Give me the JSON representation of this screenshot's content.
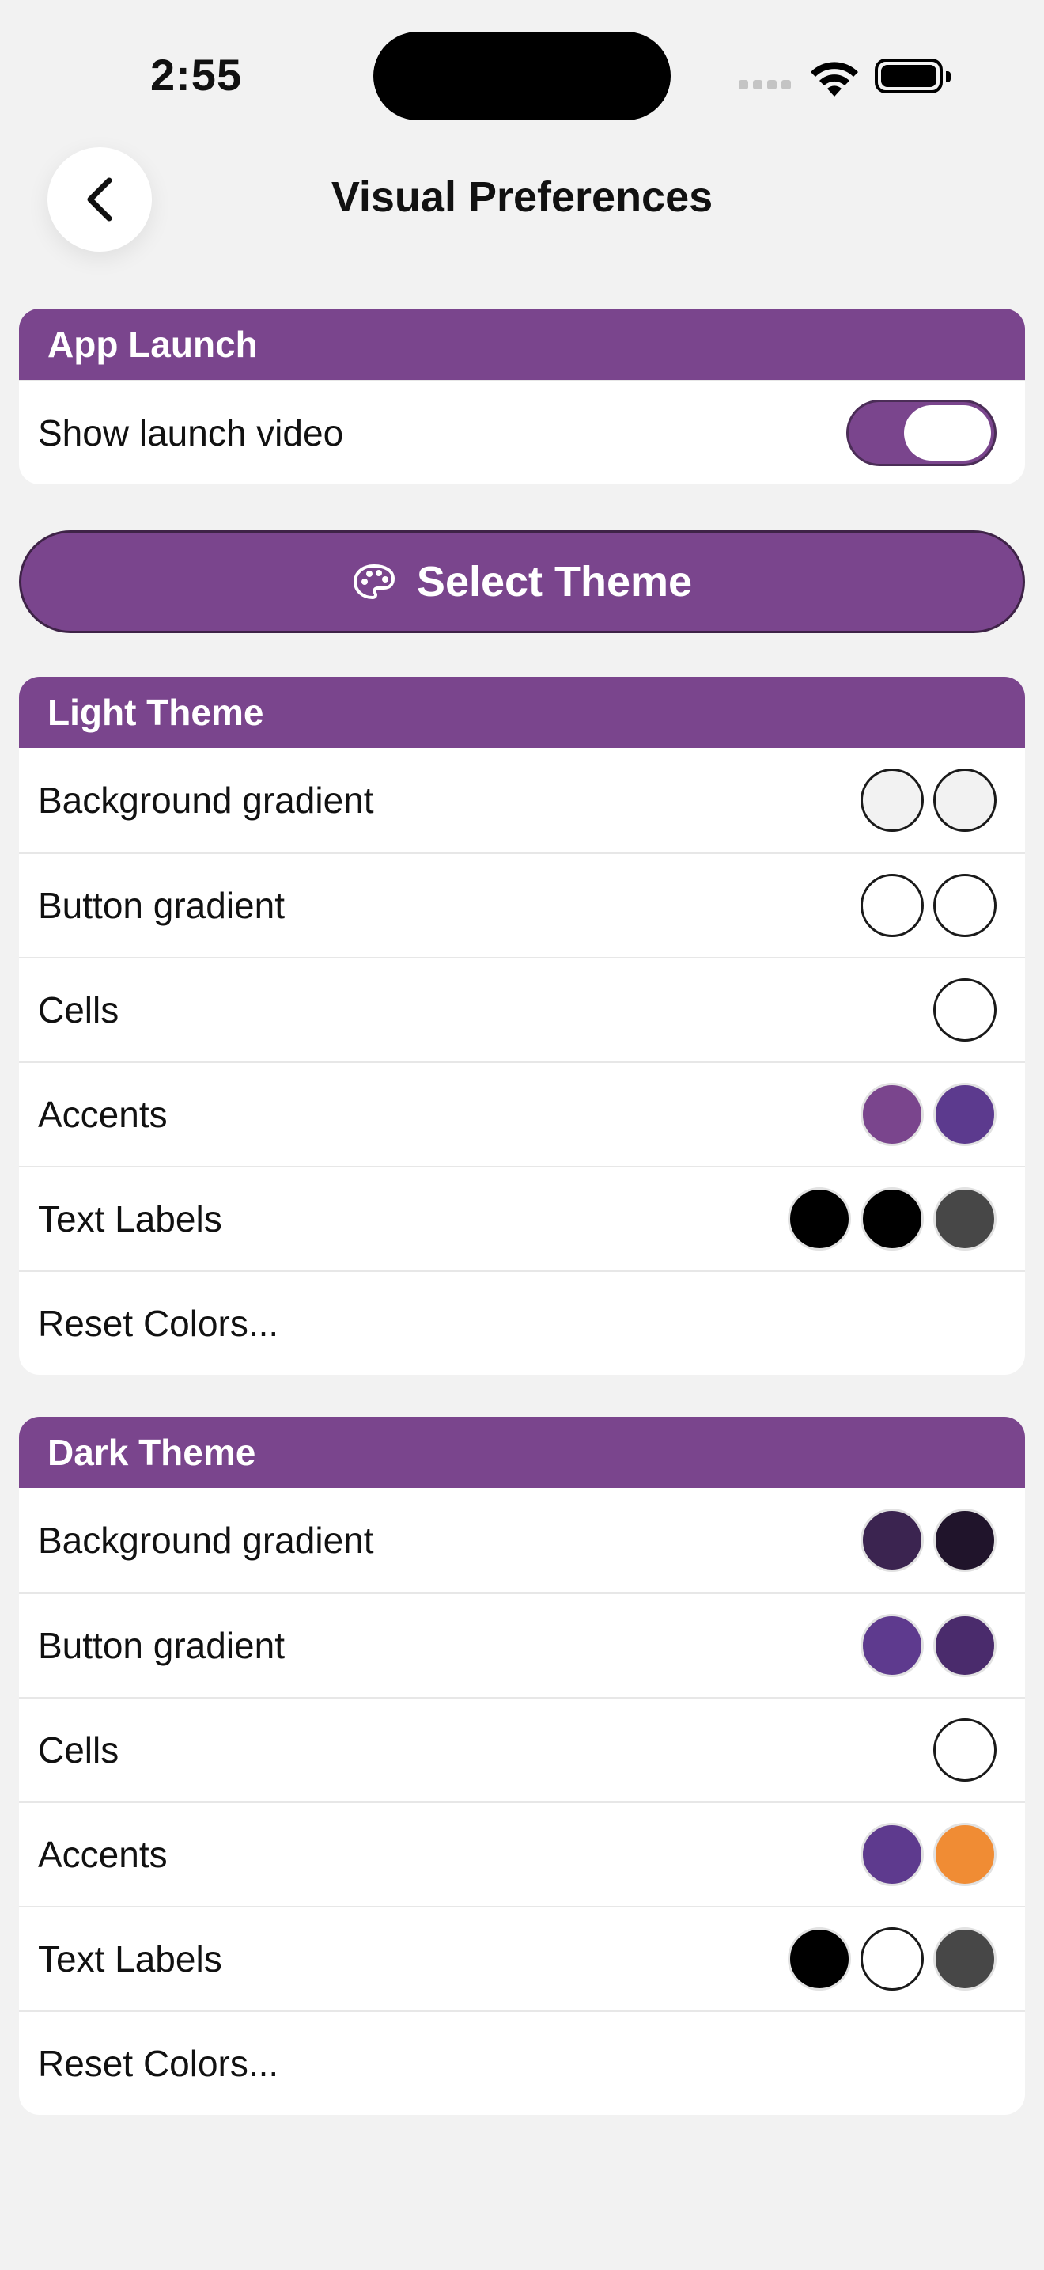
{
  "status_bar": {
    "time": "2:55"
  },
  "nav": {
    "title": "Visual Preferences",
    "back_icon": "chevron-left-icon"
  },
  "app_launch": {
    "header": "App Launch",
    "show_launch_video_label": "Show launch video",
    "show_launch_video_on": true
  },
  "select_theme": {
    "label": "Select Theme",
    "icon": "palette-icon"
  },
  "light_theme": {
    "header": "Light Theme",
    "rows": [
      {
        "label": "Background gradient",
        "colors": [
          "#f2f2f2",
          "#f2f2f2"
        ]
      },
      {
        "label": "Button gradient",
        "colors": [
          "#ffffff",
          "#ffffff"
        ]
      },
      {
        "label": "Cells",
        "colors": [
          "#ffffff"
        ]
      },
      {
        "label": "Accents",
        "colors": [
          "#7a458d",
          "#5c3a8e"
        ]
      },
      {
        "label": "Text Labels",
        "colors": [
          "#000000",
          "#000000",
          "#474747"
        ]
      }
    ],
    "reset_label": "Reset Colors..."
  },
  "dark_theme": {
    "header": "Dark Theme",
    "rows": [
      {
        "label": "Background gradient",
        "colors": [
          "#3b2450",
          "#20142b"
        ]
      },
      {
        "label": "Button gradient",
        "colors": [
          "#5e3a8e",
          "#4a2b6c"
        ]
      },
      {
        "label": "Cells",
        "colors": [
          "#ffffff"
        ]
      },
      {
        "label": "Accents",
        "colors": [
          "#5e3a8e",
          "#f08c34"
        ]
      },
      {
        "label": "Text Labels",
        "colors": [
          "#000000",
          "#ffffff",
          "#474747"
        ]
      }
    ],
    "reset_label": "Reset Colors..."
  },
  "colors": {
    "accent": "#7a458d",
    "background": "#f2f2f2"
  }
}
